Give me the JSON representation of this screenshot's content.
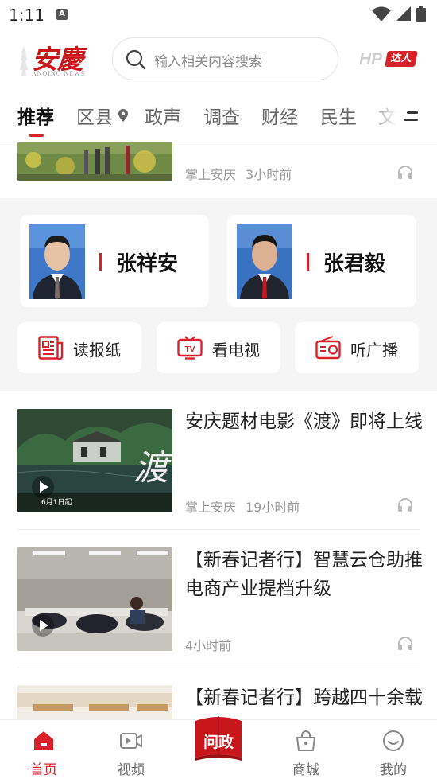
{
  "status_bar": {
    "time": "1:11",
    "notification_icon": "A"
  },
  "header": {
    "logo_cn": "安慶",
    "logo_en": "ANQING NEWS",
    "search_placeholder": "输入相关内容搜索",
    "hp_badge": {
      "hp": "HP",
      "tag": "达人"
    }
  },
  "tabs": [
    {
      "label": "推荐",
      "active": true
    },
    {
      "label": "区县",
      "icon": "location-pin-icon"
    },
    {
      "label": "政声"
    },
    {
      "label": "调查"
    },
    {
      "label": "财经"
    },
    {
      "label": "民生"
    },
    {
      "label": "文"
    }
  ],
  "news": [
    {
      "title": "",
      "source": "掌上安庆",
      "time": "3小时前"
    },
    {
      "title": "安庆题材电影《渡》即将上线",
      "source": "掌上安庆",
      "time": "19小时前",
      "thumb_text": "渡",
      "thumb_date": "6月1日起"
    },
    {
      "title": "【新春记者行】智慧云仓助推电商产业提档升级",
      "source": "",
      "time": "4小时前"
    },
    {
      "title": "【新春记者行】跨越四十余载 情谊",
      "source": "",
      "time": ""
    }
  ],
  "leaders": [
    {
      "name": "张祥安"
    },
    {
      "name": "张君毅"
    }
  ],
  "services": [
    {
      "label": "读报纸",
      "icon": "newspaper-icon"
    },
    {
      "label": "看电视",
      "icon": "tv-icon"
    },
    {
      "label": "听广播",
      "icon": "radio-icon"
    }
  ],
  "bottom_nav": {
    "items": [
      {
        "label": "首页",
        "icon": "home-icon",
        "active": true
      },
      {
        "label": "视频",
        "icon": "video-icon"
      },
      {
        "label": "商城",
        "icon": "shop-icon"
      },
      {
        "label": "我的",
        "icon": "profile-icon"
      }
    ],
    "center": {
      "label": "问政",
      "icon": "wenzheng-book-icon"
    }
  },
  "colors": {
    "accent": "#d7222a",
    "module_bg": "#f5f5f5",
    "muted": "#999999"
  }
}
